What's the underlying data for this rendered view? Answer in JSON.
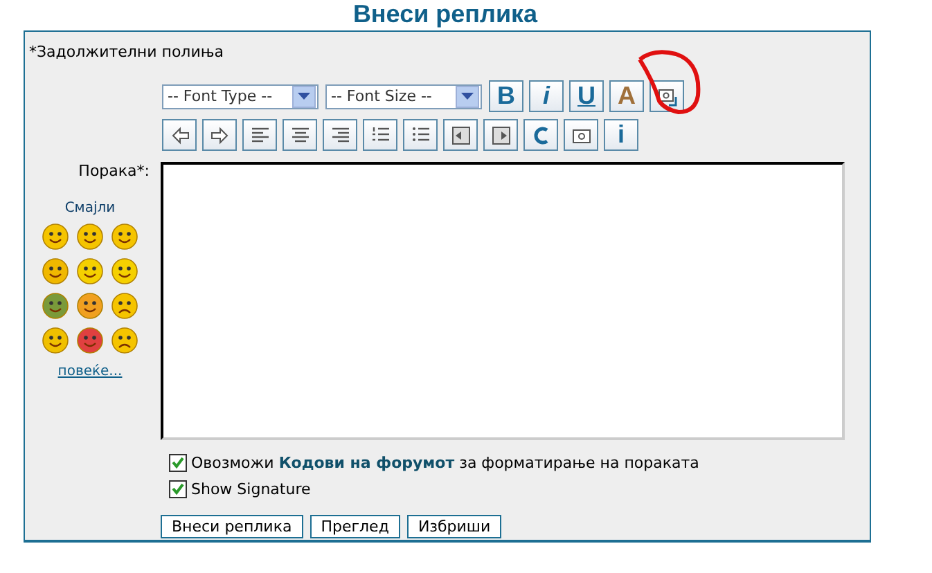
{
  "title": "Внеси реплика",
  "required_note": "*Задолжителни полиња",
  "toolbar": {
    "selects": [
      {
        "value": "-- Font Type --"
      },
      {
        "value": "-- Font Size --"
      }
    ],
    "row_1": [
      {
        "kind": "bold",
        "label": "B"
      },
      {
        "kind": "italic",
        "label": "i"
      },
      {
        "kind": "underline",
        "label": "U"
      },
      {
        "kind": "color",
        "label": "A"
      },
      {
        "kind": "image-link",
        "annotated": true
      }
    ],
    "row_2": [
      {
        "kind": "arrow-left"
      },
      {
        "kind": "arrow-right"
      },
      {
        "kind": "align-left"
      },
      {
        "kind": "align-center"
      },
      {
        "kind": "align-right"
      },
      {
        "kind": "numbered-list"
      },
      {
        "kind": "bullet-list"
      },
      {
        "kind": "outdent"
      },
      {
        "kind": "indent"
      },
      {
        "kind": "redo"
      },
      {
        "kind": "image"
      },
      {
        "kind": "info",
        "label": "i"
      }
    ]
  },
  "message": {
    "label": "Порака*:"
  },
  "smilies": {
    "title": "Смајли",
    "more": "повеќе...",
    "items": [
      {
        "color": "#f5c400"
      },
      {
        "color": "#f5c400"
      },
      {
        "color": "#f5c400"
      },
      {
        "color": "#f0b800"
      },
      {
        "color": "#f5d000"
      },
      {
        "color": "#f5d000"
      },
      {
        "color": "#7a9a3a"
      },
      {
        "color": "#f0a020"
      },
      {
        "color": "#f5c400"
      },
      {
        "color": "#f0c000"
      },
      {
        "color": "#e04040"
      },
      {
        "color": "#f5c400"
      }
    ]
  },
  "options": [
    {
      "parts": "Овозможи **Кодови на форумот** за форматирање на пораката",
      "checked": true
    },
    {
      "parts": "Show Signature",
      "checked": true
    }
  ],
  "buttons": [
    "Внеси реплика",
    "Преглед",
    "Избриши"
  ]
}
